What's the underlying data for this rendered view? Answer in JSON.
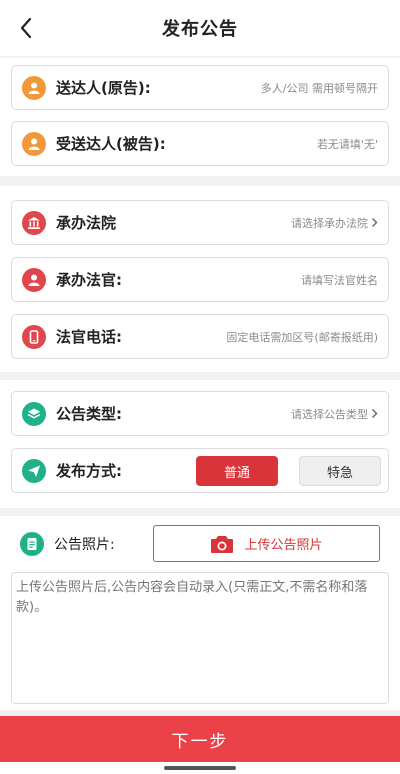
{
  "header": {
    "title": "发布公告"
  },
  "section1": {
    "plaintiff": {
      "label": "送达人(原告):",
      "placeholder": "多人/公司 需用顿号隔开",
      "icon": "person-icon",
      "color": "#f1983b"
    },
    "defendant": {
      "label": "受送达人(被告):",
      "placeholder": "若无请填'无'",
      "icon": "person-icon",
      "color": "#f1983b"
    }
  },
  "section2": {
    "court": {
      "label": "承办法院",
      "placeholder": "请选择承办法院",
      "icon": "court-icon",
      "color": "#e0474d"
    },
    "judge": {
      "label": "承办法官:",
      "placeholder": "请填写法官姓名",
      "icon": "person-icon",
      "color": "#e0474d"
    },
    "phone": {
      "label": "法官电话:",
      "placeholder": "固定电话需加区号(邮寄报纸用)",
      "icon": "phone-icon",
      "color": "#e0474d"
    }
  },
  "section3": {
    "type": {
      "label": "公告类型:",
      "placeholder": "请选择公告类型",
      "icon": "layers-icon",
      "color": "#1fb18a"
    },
    "method": {
      "label": "发布方式:",
      "icon": "send-icon",
      "color": "#1fb18a",
      "options": [
        "普通",
        "特急"
      ],
      "selected": "普通"
    }
  },
  "section4": {
    "photo": {
      "label": "公告照片:",
      "icon": "document-icon",
      "color": "#1fb18a",
      "upload_label": "上传公告照片",
      "upload_icon": "camera-icon"
    },
    "content_placeholder": "上传公告照片后,公告内容会自动录入(只需正文,不需名称和落款)。"
  },
  "footer": {
    "next_label": "下一步"
  }
}
